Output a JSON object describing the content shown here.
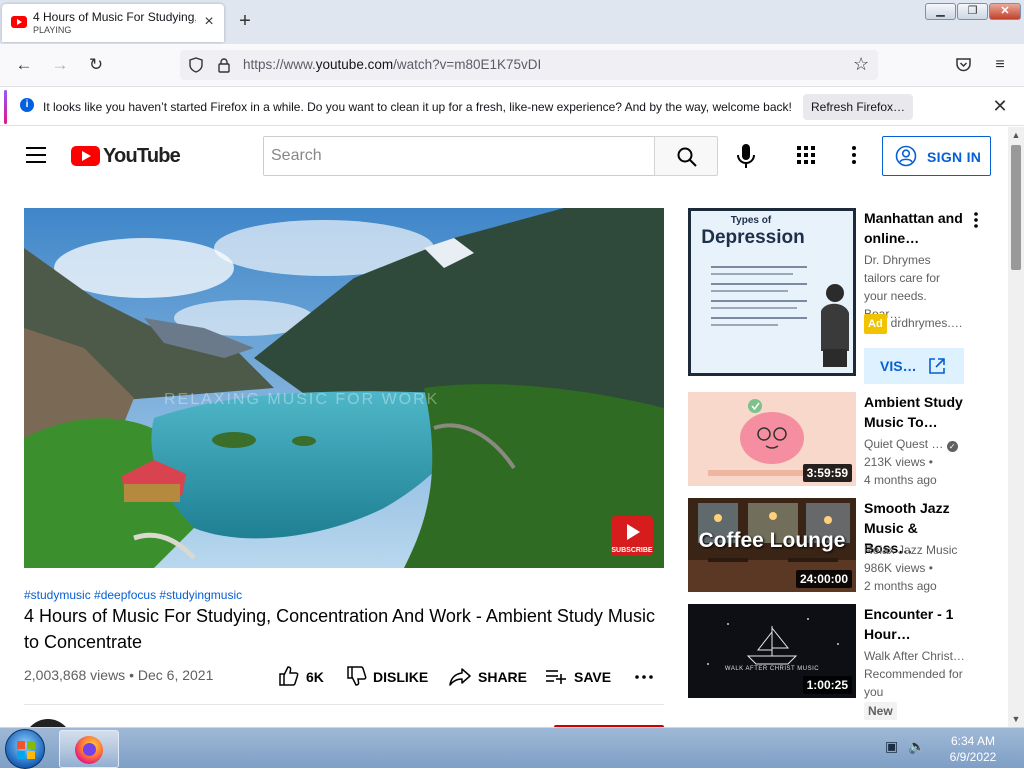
{
  "browser": {
    "tab": {
      "title": "4 Hours of Music For Studying,",
      "status": "PLAYING",
      "close_icon": "close-icon"
    },
    "new_tab_icon": "plus-icon",
    "url_prefix": "https://www.",
    "url_domain": "youtube.com",
    "url_path": "/watch?v=m80E1K75vDI",
    "notification": {
      "text": "It looks like you haven’t started Firefox in a while. Do you want to clean it up for a fresh, like-new experience? And by the way, welcome back!",
      "button": "Refresh Firefox…"
    }
  },
  "youtube": {
    "logo_text": "YouTube",
    "search_placeholder": "Search",
    "sign_in": "SIGN IN",
    "brand_color": "#ff0000",
    "link_color": "#065fd4"
  },
  "video": {
    "watermark": "RELAXING MUSIC FOR WORK",
    "subscribe_badge": "SUBSCRIBE",
    "hashtags": "#studymusic #deepfocus #studyingmusic",
    "title": "4 Hours of Music For Studying, Concentration And Work - Ambient Study Music to Concentrate",
    "views": "2,003,868 views",
    "date": "Dec 6, 2021",
    "actions": {
      "like": "6K",
      "dislike": "DISLIKE",
      "share": "SHARE",
      "save": "SAVE"
    }
  },
  "sidebar": {
    "ad": {
      "thumb_heading_small": "Types of",
      "thumb_heading": "Depression",
      "title": "Manhattan and online…",
      "description": "Dr. Dhrymes tailors care for your needs. Boar…",
      "badge": "Ad",
      "advertiser": "drdhrymes.…",
      "visit": "VIS…"
    },
    "items": [
      {
        "title": "Ambient Study Music To…",
        "channel": "Quiet Quest …",
        "verified": true,
        "views": "213K views •",
        "age": "4 months ago",
        "duration": "3:59:59"
      },
      {
        "title": "Smooth Jazz Music & Boss…",
        "thumb_text": "Coffee Lounge",
        "channel": "Relax Jazz Music",
        "views": "986K views •",
        "age": "2 months ago",
        "duration": "24:00:00"
      },
      {
        "title": "Encounter - 1 Hour…",
        "thumb_text": "WALK AFTER CHRIST MUSIC",
        "channel": "Walk After Christ…",
        "views": "Recommended for",
        "age": "you",
        "badge": "New",
        "duration": "1:00:25"
      }
    ]
  },
  "taskbar": {
    "time": "6:34 AM",
    "date": "6/9/2022"
  }
}
